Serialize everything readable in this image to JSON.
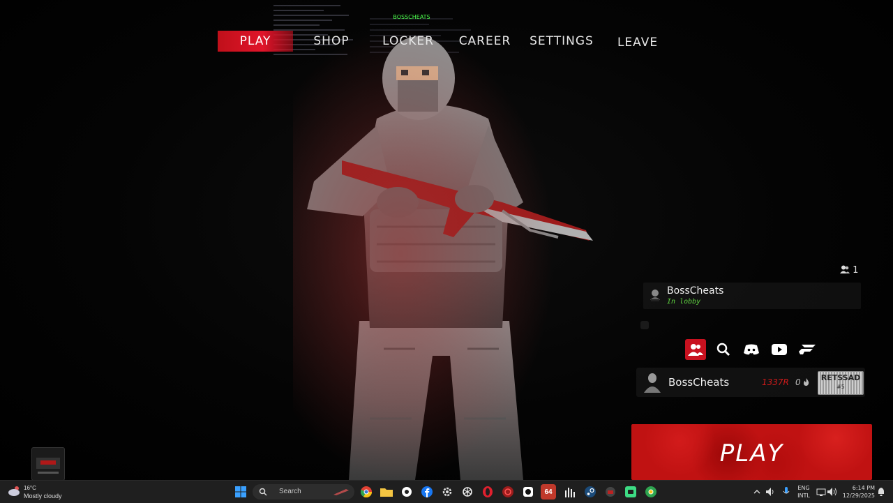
{
  "nav": {
    "items": [
      {
        "label": "PLAY",
        "active": true
      },
      {
        "label": "SHOP",
        "active": false
      },
      {
        "label": "LOCKER",
        "active": false
      },
      {
        "label": "CAREER",
        "active": false
      },
      {
        "label": "SETTINGS",
        "active": false
      },
      {
        "label": "LEAVE",
        "active": false
      }
    ]
  },
  "player_tag": "BOSSCHEATS",
  "party": {
    "count": "1",
    "friend": {
      "name": "BossCheats",
      "status": "In lobby"
    }
  },
  "social_icons": [
    "friends-icon",
    "search-icon",
    "discord-icon",
    "youtube-icon",
    "brand-icon"
  ],
  "player": {
    "name": "BossCheats",
    "rating": "1337R",
    "streak": "0",
    "badge_title": "RETSSAD",
    "badge_sub": "#5"
  },
  "play_button": "PLAY",
  "taskbar": {
    "weather_temp": "16°C",
    "weather_desc": "Mostly cloudy",
    "search_label": "Search",
    "badge_count": "64",
    "lang_top": "ENG",
    "lang_bottom": "INTL",
    "time": "6:14 PM",
    "date": "12/29/2025"
  },
  "colors": {
    "accent_red": "#c8111f",
    "status_green": "#5ed13f",
    "tag_green": "#4cff4c"
  }
}
